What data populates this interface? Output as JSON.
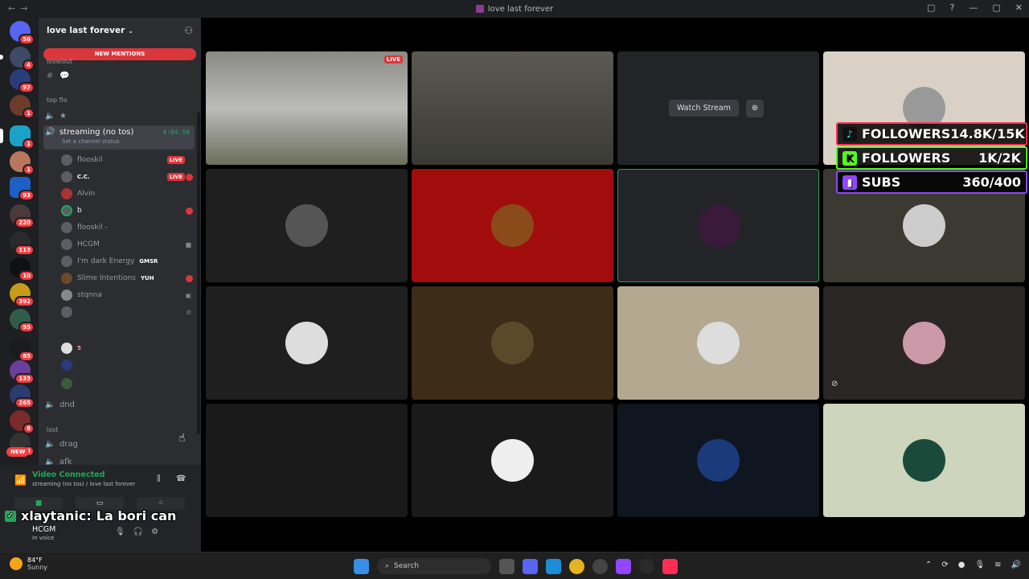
{
  "window": {
    "title": "love last forever",
    "controls": [
      "▢",
      "?",
      "—",
      "▢",
      "✕"
    ]
  },
  "server_badges": [
    {
      "n": "56"
    },
    {
      "n": "4"
    },
    {
      "n": "97"
    },
    {
      "n": "1"
    },
    {
      "n": "1"
    },
    {
      "n": "1"
    },
    {
      "n": "93"
    },
    {
      "n": "220"
    },
    {
      "n": "113"
    },
    {
      "n": "10"
    },
    {
      "n": "392"
    },
    {
      "n": "95"
    },
    {
      "n": "65"
    },
    {
      "n": "133"
    },
    {
      "n": "265"
    },
    {
      "n": "6"
    },
    {
      "n": "4"
    }
  ],
  "new_tag": "NEW",
  "guild": {
    "name": "love last forever",
    "new_mentions": "NEW MENTIONS"
  },
  "channels": {
    "cat_top": "lovelout",
    "chan_hash": "💬",
    "cat_topflo": "top flo",
    "chan_star": "★",
    "active": {
      "name": "streaming (no tos)",
      "timer": "4:04:59",
      "sub": "Set a channel status"
    },
    "dnd": "dnd",
    "cat_lost": "lost",
    "drag": "drag",
    "afk": "afk"
  },
  "voice_users": [
    {
      "name": "flooskil",
      "live": "LIVE"
    },
    {
      "name": "C.C.",
      "live": "LIVE"
    },
    {
      "name": "Alvin"
    },
    {
      "name": "b"
    },
    {
      "name": "flooskil -"
    },
    {
      "name": "HCGM"
    },
    {
      "name": "I'm dark Energy",
      "tag": "GMSR"
    },
    {
      "name": "Slime Intentions",
      "tag": "YUH"
    },
    {
      "name": "stqnna"
    },
    {
      "name": ""
    },
    {
      "name": "",
      "tag": "5"
    }
  ],
  "vc_panel": {
    "status": "Video Connected",
    "sub": "streaming (no tos) / love last forever"
  },
  "user": {
    "name": "HCGM",
    "status": "In voice"
  },
  "chat_overlay": {
    "user": "xlaytanic:",
    "message": "La bori can"
  },
  "stage": {
    "live": "LIVE",
    "watch_stream": "Watch Stream"
  },
  "stats": [
    {
      "label": "FOLLOWERS",
      "value": "14.8K/15K",
      "color": "#ff2d55",
      "icon": "tiktok-icon",
      "glyph": "♪"
    },
    {
      "label": "FOLLOWERS",
      "value": "1K/2K",
      "color": "#53fc18",
      "icon": "kick-icon",
      "glyph": "K"
    },
    {
      "label": "SUBS",
      "value": "360/400",
      "color": "#9146ff",
      "icon": "twitch-icon",
      "glyph": "▮"
    }
  ],
  "taskbar": {
    "temp": "84°F",
    "weather": "Sunny",
    "search": "Search"
  }
}
